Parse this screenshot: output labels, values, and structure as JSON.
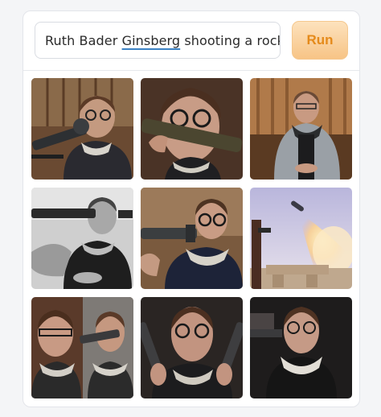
{
  "prompt": {
    "value_before": "Ruth Bader ",
    "value_underlined": "Ginsberg",
    "value_after": " shooting a rocket pro"
  },
  "run_label": "Run",
  "colors": {
    "accent": "#e58a1a",
    "button_bg": "#f7c486",
    "spellcheck_underline": "#3b82c4"
  },
  "gallery": {
    "images": [
      {
        "name": "generated-image-1",
        "scene": "judge with telescope-like bazooka, wooden background"
      },
      {
        "name": "generated-image-2",
        "scene": "close-up judge holding long tube"
      },
      {
        "name": "generated-image-3",
        "scene": "judge seated in robe, wood panel"
      },
      {
        "name": "generated-image-4",
        "scene": "black and white judge with launcher"
      },
      {
        "name": "generated-image-5",
        "scene": "judge aiming launcher"
      },
      {
        "name": "generated-image-6",
        "scene": "rocket launching in sky over stones"
      },
      {
        "name": "generated-image-7",
        "scene": "judge with cannon, split image"
      },
      {
        "name": "generated-image-8",
        "scene": "judge holding two launchers"
      },
      {
        "name": "generated-image-9",
        "scene": "judge with lace collar, dark background"
      }
    ]
  }
}
